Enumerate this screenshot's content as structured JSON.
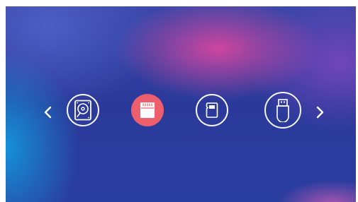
{
  "navigation": {
    "prev_icon": "chevron-left-icon",
    "next_icon": "chevron-right-icon"
  },
  "storage_devices": [
    {
      "id": "hard-disk",
      "icon": "hard-disk-icon",
      "selected": false
    },
    {
      "id": "sd-card",
      "icon": "sd-card-icon",
      "selected": true
    },
    {
      "id": "micro-sd-card",
      "icon": "micro-sd-card-icon",
      "selected": false
    },
    {
      "id": "usb-drive",
      "icon": "usb-drive-icon",
      "selected": false
    }
  ],
  "colors": {
    "selected_fill": "#ee5f6e",
    "icon_stroke": "#ffffff"
  }
}
